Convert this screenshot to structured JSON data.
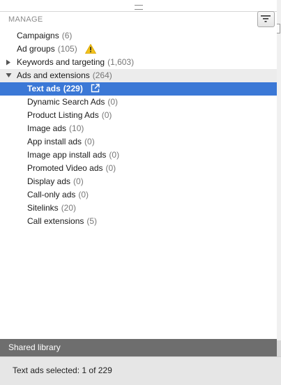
{
  "panel": {
    "section_header": "MANAGE",
    "filter_button_icon": "filter-icon"
  },
  "tree": {
    "campaigns": {
      "label": "Campaigns",
      "count": "(6)"
    },
    "ad_groups": {
      "label": "Ad groups",
      "count": "(105)",
      "warning_icon": "warning-icon"
    },
    "keywords": {
      "label": "Keywords and targeting",
      "count": "(1,603)",
      "expander": "collapsed"
    },
    "ads_ext": {
      "label": "Ads and extensions",
      "count": "(264)",
      "expander": "expanded"
    },
    "children": [
      {
        "label": "Text ads",
        "count": "(229)",
        "selected": true,
        "icon": "external-link-icon"
      },
      {
        "label": "Dynamic Search Ads",
        "count": "(0)"
      },
      {
        "label": "Product Listing Ads",
        "count": "(0)"
      },
      {
        "label": "Image ads",
        "count": "(10)"
      },
      {
        "label": "App install ads",
        "count": "(0)"
      },
      {
        "label": "Image app install ads",
        "count": "(0)"
      },
      {
        "label": "Promoted Video ads",
        "count": "(0)"
      },
      {
        "label": "Display ads",
        "count": "(0)"
      },
      {
        "label": "Call-only ads",
        "count": "(0)"
      },
      {
        "label": "Sitelinks",
        "count": "(20)"
      },
      {
        "label": "Call extensions",
        "count": "(5)"
      }
    ]
  },
  "shared_library": {
    "label": "Shared library"
  },
  "status": {
    "text": "Text ads selected: 1 of 229"
  },
  "colors": {
    "selection": "#3b78d6",
    "shared_library_bg": "#6e6e6e",
    "status_bar_bg": "#e6e6e6",
    "warning": "#f2c21b"
  }
}
